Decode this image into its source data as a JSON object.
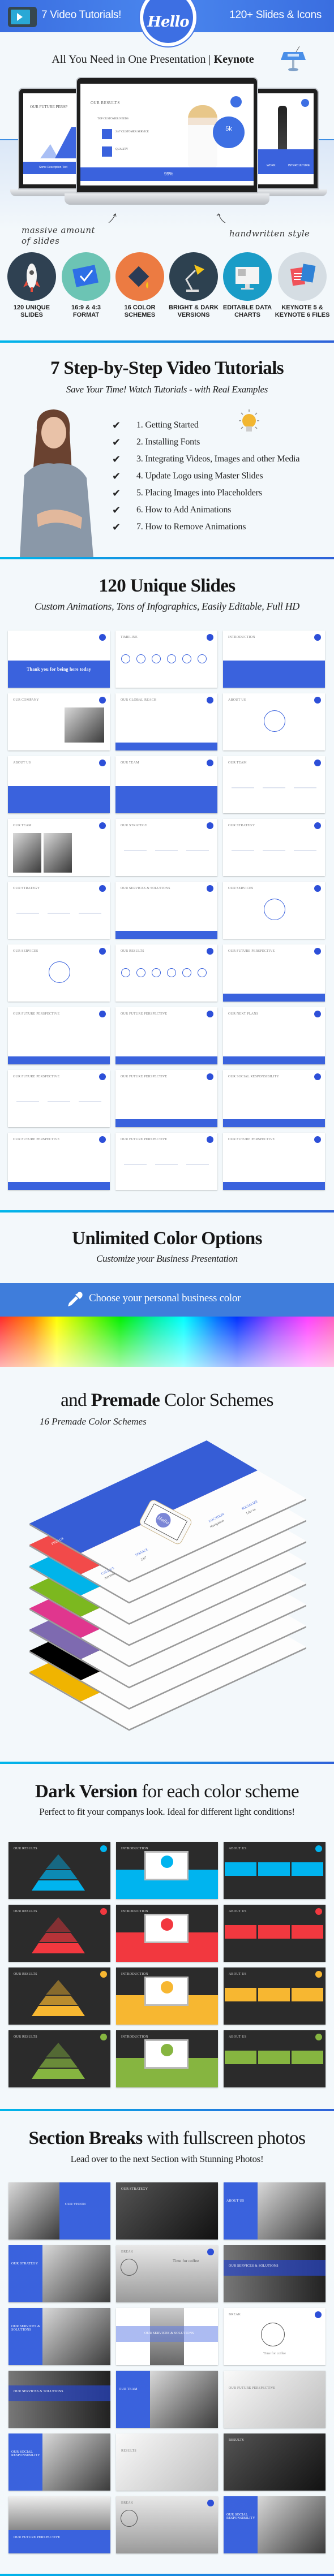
{
  "header": {
    "tutorials_label": "7 Video Tutorials!",
    "logo_text": "Hello",
    "slides_icons_label": "120+ Slides & Icons",
    "brand_color": "#3d6fe3"
  },
  "hero": {
    "title_main": "All You Need in One Presentation",
    "title_sep": "|",
    "title_app": "Keynote",
    "note_left": "massive amount of slides",
    "note_right": "handwritten style",
    "center_slide": {
      "title": "OUR RESULTS",
      "section": "TOP CUSTOMER NEEDS",
      "items": [
        "24/7 CUSTOMER SERVICE",
        "QUALITY"
      ],
      "stat": "5k",
      "footer_stat": "99%"
    },
    "left_slide_title": "OUR FUTURE PERSP",
    "left_slide_footer": "Some Description Text",
    "right_slide_labels": [
      "WORK",
      "INTERCULTURE"
    ]
  },
  "features": [
    {
      "label": "120 UNIQUE SLIDES",
      "icon": "rocket-icon",
      "color": "#2f4152"
    },
    {
      "label": "16:9 & 4:3 FORMAT",
      "icon": "blueprint-icon",
      "color": "#6cc4b4"
    },
    {
      "label": "16 COLOR SCHEMES",
      "icon": "paint-bucket-icon",
      "color": "#ec7b42"
    },
    {
      "label": "BRIGHT & DARK VERSIONS",
      "icon": "desk-lamp-icon",
      "color": "#2d4150"
    },
    {
      "label": "EDITABLE DATA CHARTS",
      "icon": "monitor-icon",
      "color": "#1a9cc7"
    },
    {
      "label": "KEYNOTE 5 & KEYNOTE 6 FILES",
      "icon": "files-icon",
      "color": "#d5dde3"
    }
  ],
  "tutorials": {
    "title": "7 Step-by-Step Video Tutorials",
    "subtitle": "Save Your Time! Watch Tutorials - with Real Examples",
    "items": [
      "1. Getting Started",
      "2. Installing Fonts",
      "3. Integrating Videos, Images and other Media",
      "4. Update Logo using Master Slides",
      "5. Placing Images into Placeholders",
      "6. How to Add Animations",
      "7. How to Remove Animations"
    ]
  },
  "unique_slides": {
    "title": "120 Unique Slides",
    "subtitle": "Custom Animations, Tons of Infographics, Easily Editable, Full HD",
    "slides": [
      {
        "title": "Thank you for being here today",
        "variant": "half"
      },
      {
        "title": "TIMELINE",
        "variant": "timeline"
      },
      {
        "title": "INTRODUCTION",
        "variant": "half"
      },
      {
        "title": "OUR COMPANY",
        "variant": "photo-right"
      },
      {
        "title": "OUR GLOBAL REACH",
        "variant": "band"
      },
      {
        "title": "ABOUT US",
        "variant": "circle"
      },
      {
        "title": "ABOUT US",
        "variant": "half"
      },
      {
        "title": "OUR TEAM",
        "variant": "half"
      },
      {
        "title": "OUR TEAM",
        "variant": "white"
      },
      {
        "title": "OUR TEAM",
        "variant": "photo-left"
      },
      {
        "title": "OUR STRATEGY",
        "variant": "white"
      },
      {
        "title": "OUR STRATEGY",
        "variant": "white"
      },
      {
        "title": "OUR STRATEGY",
        "variant": "white"
      },
      {
        "title": "OUR SERVICES & SOLUTIONS",
        "variant": "band"
      },
      {
        "title": "OUR SERVICES",
        "variant": "circle"
      },
      {
        "title": "OUR SERVICES",
        "variant": "circle"
      },
      {
        "title": "OUR RESULTS",
        "variant": "timeline"
      },
      {
        "title": "OUR FUTURE PERSPECTIVE",
        "variant": "band"
      },
      {
        "title": "OUR FUTURE PERSPECTIVE",
        "variant": "band"
      },
      {
        "title": "OUR FUTURE PERSPECTIVE",
        "variant": "band"
      },
      {
        "title": "OUR NEXT PLANS",
        "variant": "band"
      },
      {
        "title": "OUR FUTURE PERSPECTIVE",
        "variant": "white"
      },
      {
        "title": "OUR FUTURE PERSPECTIVE",
        "variant": "band"
      },
      {
        "title": "OUR SOCIAL RESPONSIBILITY",
        "variant": "band"
      },
      {
        "title": "OUR FUTURE PERSPECTIVE",
        "variant": "band"
      },
      {
        "title": "OUR FUTURE PERSPECTIVE",
        "variant": "white"
      },
      {
        "title": "OUR FUTURE PERSPECTIVE",
        "variant": "band"
      }
    ]
  },
  "colors": {
    "title": "Unlimited Color Options",
    "subtitle": "Customize your Business Presentation",
    "picker_label": "Choose your personal business color",
    "picker_band_color": "#3f7ddb",
    "premade_pre": "and",
    "premade_bold": "Premade",
    "premade_post": "Color Schemes",
    "premade_subtitle": "16 Premade Color Schemes",
    "scheme_colors": [
      "#f0b400",
      "#000000",
      "#7e6ab0",
      "#e0368e",
      "#7cb81f",
      "#00b4ea",
      "#f24a4a",
      "#365dd6"
    ],
    "top_slide_labels": [
      "FIND US",
      "SERVICE",
      "24/7",
      "CALL US",
      "Anytime",
      "LOCATION",
      "Navigation",
      "SOCIALIZE",
      "Like us"
    ],
    "phone_logo": "Hello"
  },
  "dark": {
    "title_bold": "Dark Version",
    "title_rest": "for each color scheme",
    "subtitle": "Perfect to fit your companys look. Ideal for different light conditions!",
    "slide_titles": [
      "OUR RESULTS",
      "INTRODUCTION",
      "ABOUT US"
    ],
    "row_colors": [
      "#00b4ef",
      "#f2383f",
      "#f7b731",
      "#86b540"
    ]
  },
  "section_breaks": {
    "title_bold": "Section Breaks",
    "title_rest": "with fullscreen photos",
    "subtitle": "Lead over to the next Section with Stunning Photos!",
    "slides": [
      {
        "title": "OUR VISION",
        "variant": "photo-left-blue-right"
      },
      {
        "title": "OUR STRATEGY",
        "variant": "photo"
      },
      {
        "title": "ABOUT US",
        "variant": "blue-left"
      },
      {
        "title": "OUR STRATEGY",
        "variant": "blue-left"
      },
      {
        "title": "BREAK",
        "variant": "photo-break",
        "caption": "Time for coffee"
      },
      {
        "title": "OUR SERVICES & SOLUTIONS",
        "variant": "photo-band"
      },
      {
        "title": "OUR SERVICES & SOLUTIONS",
        "variant": "blue-left"
      },
      {
        "title": "OUR SERVICES & SOLUTIONS",
        "variant": "light-band"
      },
      {
        "title": "BREAK",
        "variant": "white-break",
        "caption": "Time for coffee"
      },
      {
        "title": "OUR SERVICES & SOLUTIONS",
        "variant": "photo-band"
      },
      {
        "title": "OUR TEAM",
        "variant": "blue-left"
      },
      {
        "title": "OUR FUTURE PERSPECTIVE",
        "variant": "light-photo"
      },
      {
        "title": "OUR SOCIAL RESPONSIBILITY",
        "variant": "blue-left"
      },
      {
        "title": "RESULTS",
        "variant": "light-photo"
      },
      {
        "title": "RESULTS",
        "variant": "photo"
      },
      {
        "title": "OUR FUTURE PERSPECTIVE",
        "variant": "photo-bottom-band"
      },
      {
        "title": "BREAK",
        "variant": "photo-break"
      },
      {
        "title": "OUR SOCIAL RESPONSIBILITY",
        "variant": "blue-left"
      }
    ]
  }
}
